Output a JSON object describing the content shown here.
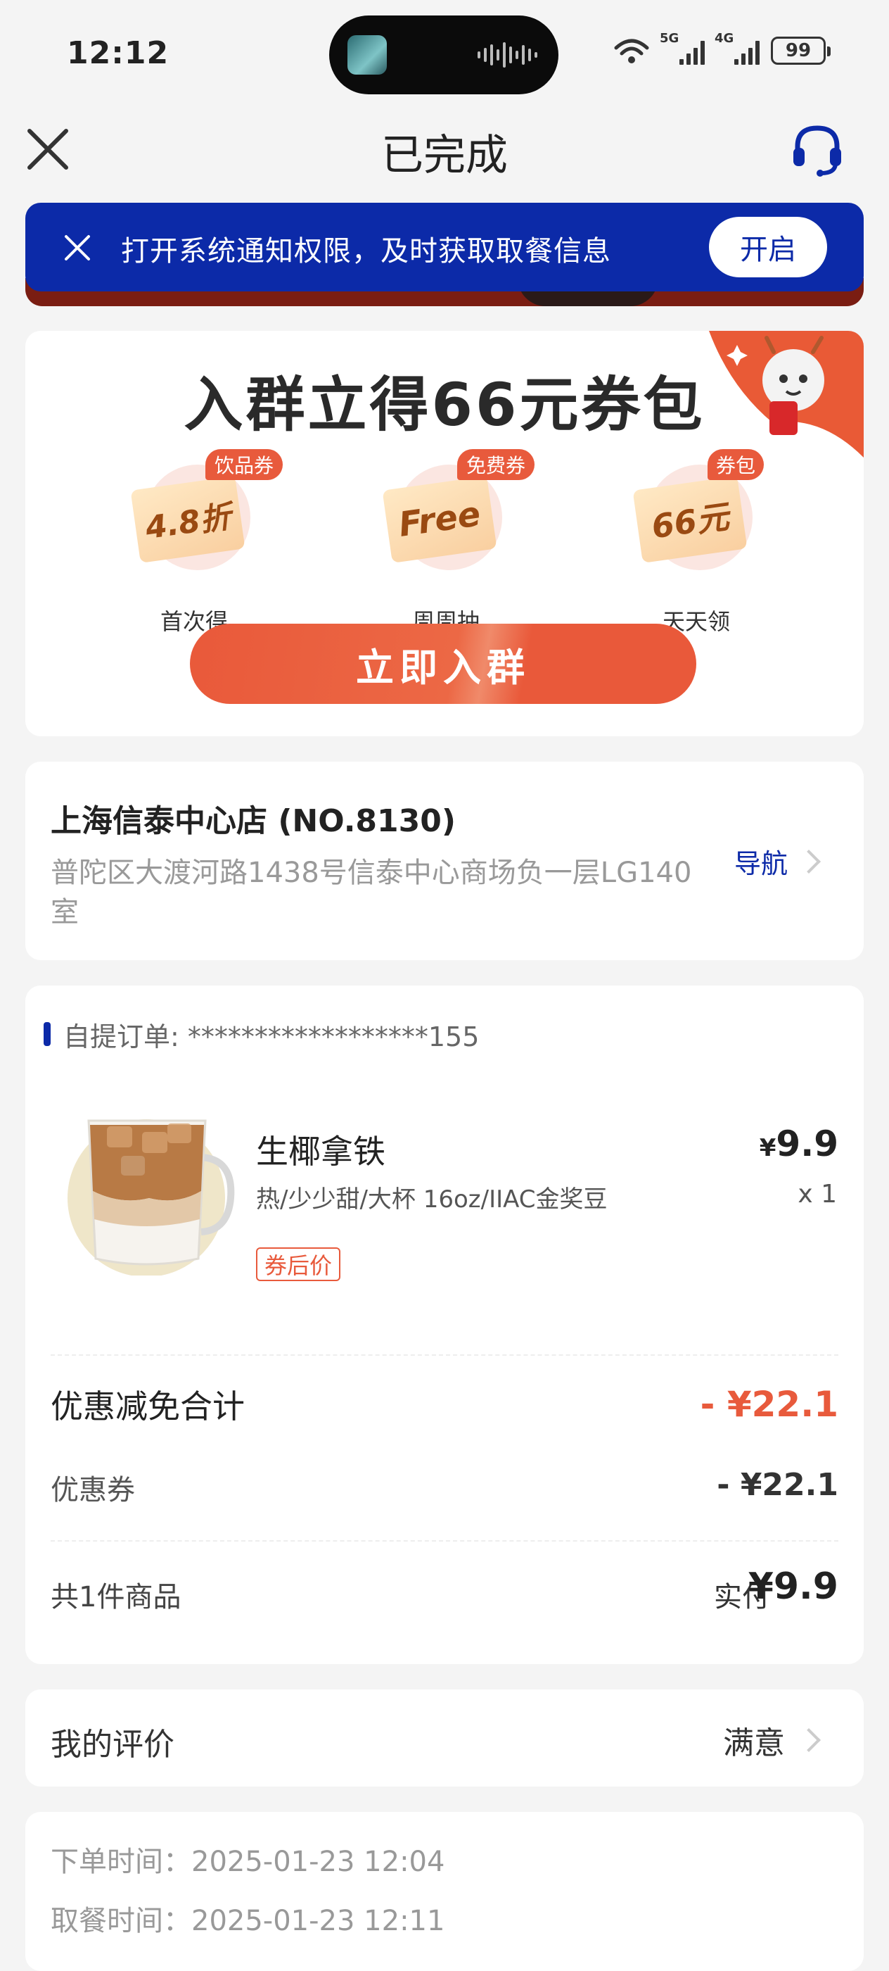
{
  "status_bar": {
    "time": "12:12",
    "net1": "5G",
    "net2": "4G",
    "battery": "99"
  },
  "nav": {
    "title": "已完成"
  },
  "banner": {
    "text": "打开系统通知权限，及时获取取餐信息",
    "button": "开启"
  },
  "promo": {
    "title": "入群立得66元券包",
    "tickets": [
      {
        "tag": "饮品券",
        "face": "4.8折",
        "label": "首次得"
      },
      {
        "tag": "免费券",
        "face": "Free",
        "label": "周周抽"
      },
      {
        "tag": "券包",
        "face": "66元",
        "label": "天天领"
      }
    ],
    "button": "立即入群"
  },
  "store": {
    "name": "上海信泰中心店 (NO.8130)",
    "address": "普陀区大渡河路1438号信泰中心商场负一层LG140室",
    "nav_label": "导航"
  },
  "order": {
    "id_label": "自提订单: ******************155",
    "product": {
      "name": "生椰拿铁",
      "options": "热/少少甜/大杯 16oz/IIAC金奖豆",
      "badge": "券后价",
      "currency": "¥",
      "price": "9.9",
      "qty": "x 1"
    },
    "discount_label": "优惠减免合计",
    "discount_value": "- ¥22.1",
    "coupon_label": "优惠券",
    "coupon_value": "- ¥22.1",
    "count_label": "共1件商品",
    "paid_label": "实付",
    "paid_value": "¥9.9"
  },
  "rating": {
    "label": "我的评价",
    "value": "满意"
  },
  "times": {
    "order_time": "下单时间：2025-01-23 12:04",
    "pickup_time": "取餐时间：2025-01-23 12:11"
  },
  "colors": {
    "brand_blue": "#0c2aa8",
    "accent_red": "#e85a3c",
    "page_bg": "#f4f4f4"
  },
  "icons": [
    "close-icon",
    "headset-icon",
    "chevron-right-icon",
    "coupon-mascot-icon"
  ]
}
